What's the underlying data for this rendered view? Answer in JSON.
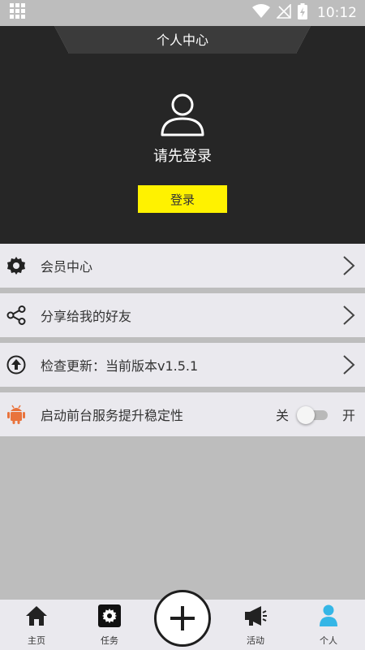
{
  "status_bar": {
    "time": "10:12"
  },
  "header": {
    "title": "个人中心",
    "login_prompt": "请先登录",
    "login_button": "登录"
  },
  "menu": {
    "items": [
      {
        "label": "会员中心",
        "icon": "gear-icon"
      },
      {
        "label": "分享给我的好友",
        "icon": "share-icon"
      },
      {
        "label": "检查更新：当前版本v1.5.1",
        "icon": "update-icon"
      },
      {
        "label": "启动前台服务提升稳定性",
        "icon": "android-icon"
      }
    ],
    "toggle": {
      "off_label": "关",
      "on_label": "开",
      "state": "off"
    }
  },
  "bottom_nav": {
    "items": [
      {
        "label": "主页",
        "icon": "home-icon"
      },
      {
        "label": "任务",
        "icon": "task-icon"
      },
      {
        "label": "",
        "icon": "add-icon"
      },
      {
        "label": "活动",
        "icon": "megaphone-icon"
      },
      {
        "label": "个人",
        "icon": "person-icon"
      }
    ]
  },
  "colors": {
    "header_bg": "#262626",
    "accent_yellow": "#fff200",
    "page_bg": "#bdbdbd",
    "row_bg": "#eae9ee",
    "android_orange": "#e9733c",
    "active_nav": "#35b6e6"
  }
}
